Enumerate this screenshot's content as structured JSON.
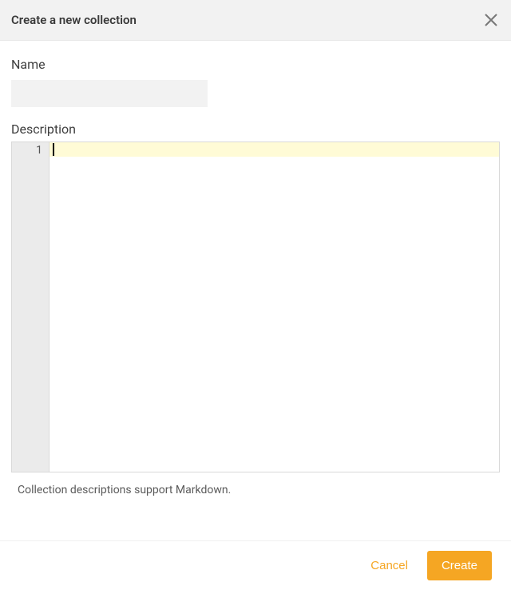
{
  "header": {
    "title": "Create a new collection"
  },
  "form": {
    "name_label": "Name",
    "name_value": "",
    "description_label": "Description",
    "description_value": "",
    "line_number": "1",
    "hint": "Collection descriptions support Markdown."
  },
  "footer": {
    "cancel_label": "Cancel",
    "create_label": "Create"
  }
}
